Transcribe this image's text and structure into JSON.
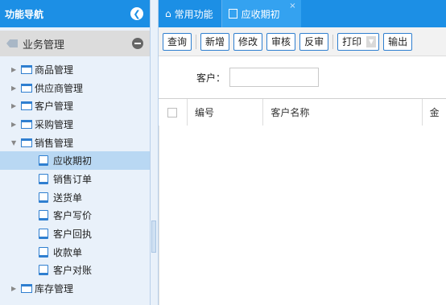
{
  "sidebar": {
    "title": "功能导航",
    "collapse_glyph": "❮",
    "module": {
      "label": "业务管理"
    },
    "groups": [
      {
        "label": "商品管理",
        "expanded": false
      },
      {
        "label": "供应商管理",
        "expanded": false
      },
      {
        "label": "客户管理",
        "expanded": false
      },
      {
        "label": "采购管理",
        "expanded": false
      },
      {
        "label": "销售管理",
        "expanded": true
      }
    ],
    "sales_children": [
      {
        "label": "应收期初",
        "selected": true
      },
      {
        "label": "销售订单"
      },
      {
        "label": "送货单"
      },
      {
        "label": "客户写价"
      },
      {
        "label": "客户回执"
      },
      {
        "label": "收款单"
      },
      {
        "label": "客户对账"
      }
    ],
    "after_groups": [
      {
        "label": "库存管理",
        "expanded": false
      }
    ]
  },
  "tabs": {
    "home": {
      "label": "常用功能",
      "icon": "home-icon"
    },
    "active": {
      "label": "应收期初",
      "icon": "page-icon",
      "close": "×"
    }
  },
  "toolbar": {
    "query": "查询",
    "add": "新增",
    "edit": "修改",
    "review": "审核",
    "unreview": "反审",
    "print": "打印",
    "export": "输出"
  },
  "filter": {
    "customer_label": "客户：",
    "customer_value": ""
  },
  "grid": {
    "columns": [
      "编号",
      "客户名称",
      "金"
    ]
  },
  "colors": {
    "header_blue": "#1c8fe5",
    "active_tab": "#34a2f0",
    "selected_row": "#b9d8f3",
    "button_border": "#2f7fd0"
  }
}
